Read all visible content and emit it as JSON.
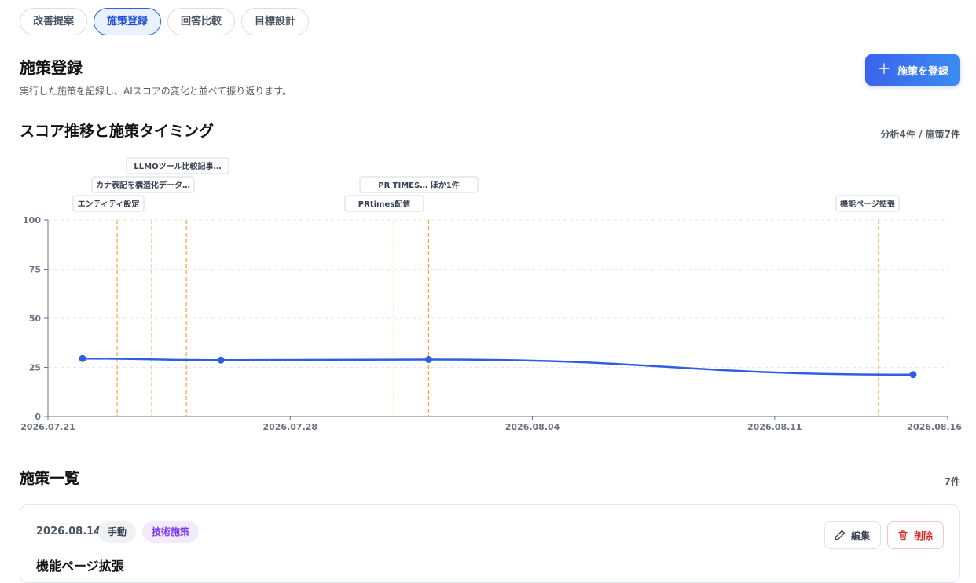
{
  "tabs": [
    {
      "label": "改善提案",
      "active": false
    },
    {
      "label": "施策登録",
      "active": true
    },
    {
      "label": "回答比較",
      "active": false
    },
    {
      "label": "目標設計",
      "active": false
    }
  ],
  "header": {
    "title": "施策登録",
    "description": "実行した施策を記録し、AIスコアの変化と並べて振り返ります。",
    "register_button": {
      "label": "施策を登録",
      "icon": "plus-icon"
    }
  },
  "chart_section": {
    "title": "スコア推移と施策タイミング",
    "count": "分析4件 / 施策7件"
  },
  "chart_data": {
    "type": "line",
    "x_axis": {
      "ticks": [
        "2026.07.21",
        "2026.07.28",
        "2026.08.04",
        "2026.08.11",
        "2026.08.16"
      ],
      "range": [
        "2026-07-21",
        "2026-08-16"
      ]
    },
    "y_axis": {
      "ticks": [
        0,
        25,
        50,
        75,
        100
      ],
      "range": [
        0,
        100
      ]
    },
    "grid": true,
    "series": [
      {
        "points": [
          {
            "x": "2026-07-22",
            "y": 29.5
          },
          {
            "x": "2026-07-26",
            "y": 28.7
          },
          {
            "x": "2026-08-01",
            "y": 29.0
          },
          {
            "x": "2026-08-15",
            "y": 21.3
          }
        ],
        "color": "#2f5fe0"
      }
    ],
    "event_markers": [
      {
        "x": "2026-07-23",
        "label": "エンティティ設定"
      },
      {
        "x": "2026-07-24",
        "label": "カナ表記を構造化データ…"
      },
      {
        "x": "2026-07-25",
        "label": "LLMOツール比較記事…"
      },
      {
        "x": "2026-07-31",
        "label": "PRtimes配信"
      },
      {
        "x": "2026-08-01",
        "label": "PR TIMES… ほか1件"
      },
      {
        "x": "2026-08-14",
        "label": "機能ページ拡張"
      }
    ],
    "marker_color": "#f4a340"
  },
  "list_section": {
    "title": "施策一覧",
    "count": "7件"
  },
  "items": [
    {
      "date": "2026.08.14",
      "source_badge": "手動",
      "category_badge": "技術施策",
      "title": "機能ページ拡張",
      "edit_label": "編集",
      "delete_label": "削除"
    }
  ]
}
